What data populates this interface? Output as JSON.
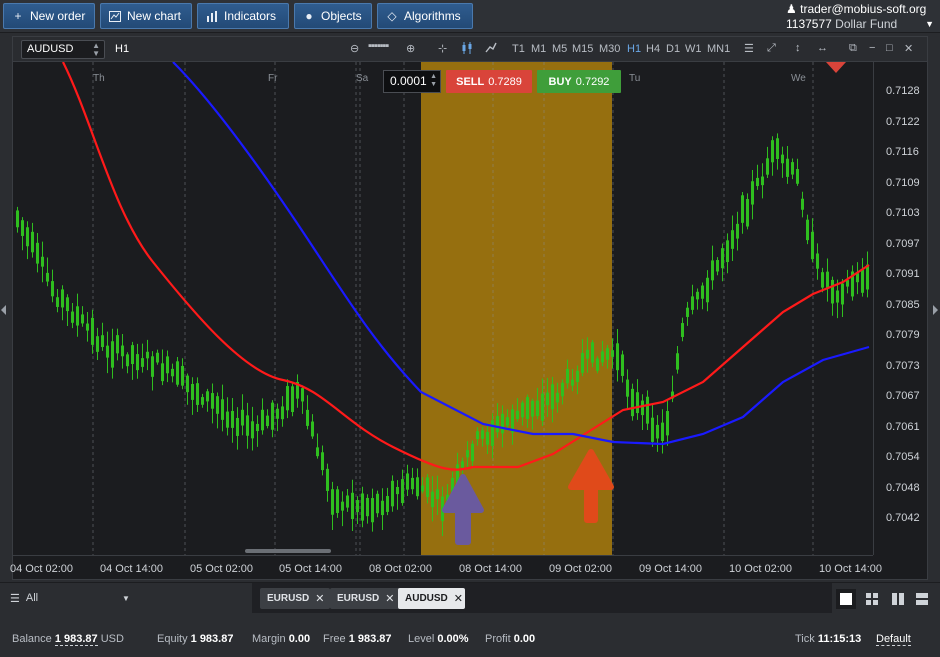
{
  "toolbar": {
    "new_order": "New order",
    "new_chart": "New chart",
    "indicators": "Indicators",
    "objects": "Objects",
    "algorithms": "Algorithms"
  },
  "account": {
    "email": "trader@mobius-soft.org",
    "id": "1137577",
    "fund": "Dollar Fund"
  },
  "chart": {
    "symbol": "AUDUSD",
    "timeframe": "H1",
    "timeframes": [
      "T1",
      "M1",
      "M5",
      "M15",
      "M30",
      "H1",
      "H4",
      "D1",
      "W1",
      "MN1"
    ],
    "active_timeframe": "H1",
    "lot": "0.0001",
    "sell_label": "SELL",
    "sell_price": "0.7289",
    "buy_label": "BUY",
    "buy_price": "0.7292",
    "day_labels": [
      "Th",
      "Fr",
      "Sa",
      "Tu",
      "We"
    ],
    "price_ticks": [
      "0.7128",
      "0.7122",
      "0.7116",
      "0.7109",
      "0.7103",
      "0.7097",
      "0.7091",
      "0.7085",
      "0.7079",
      "0.7073",
      "0.7067",
      "0.7061",
      "0.7054",
      "0.7048",
      "0.7042"
    ],
    "time_ticks": [
      "04 Oct 02:00",
      "04 Oct 14:00",
      "05 Oct 02:00",
      "05 Oct 14:00",
      "08 Oct 02:00",
      "08 Oct 14:00",
      "09 Oct 02:00",
      "09 Oct 14:00",
      "10 Oct 02:00",
      "10 Oct 14:00"
    ],
    "colors": {
      "bull": "#2fbf1f",
      "bear": "#2fbf1f",
      "ma_red": "#ff1a1a",
      "ma_blue": "#1a1aff",
      "highlight": "#b8860b",
      "arrow_purple": "#6a5a9e",
      "arrow_orange": "#e04a1a"
    }
  },
  "bottom": {
    "filter": "All",
    "tabs": [
      "EURUSD",
      "EURUSD",
      "AUDUSD"
    ],
    "active_tab": "AUDUSD"
  },
  "status": {
    "balance_label": "Balance",
    "balance": "1 983.87",
    "currency": "USD",
    "equity_label": "Equity",
    "equity": "1 983.87",
    "margin_label": "Margin",
    "margin": "0.00",
    "free_label": "Free",
    "free": "1 983.87",
    "level_label": "Level",
    "level": "0.00%",
    "profit_label": "Profit",
    "profit": "0.00",
    "tick_label": "Tick",
    "tick_time": "11:15:13",
    "default_label": "Default"
  }
}
